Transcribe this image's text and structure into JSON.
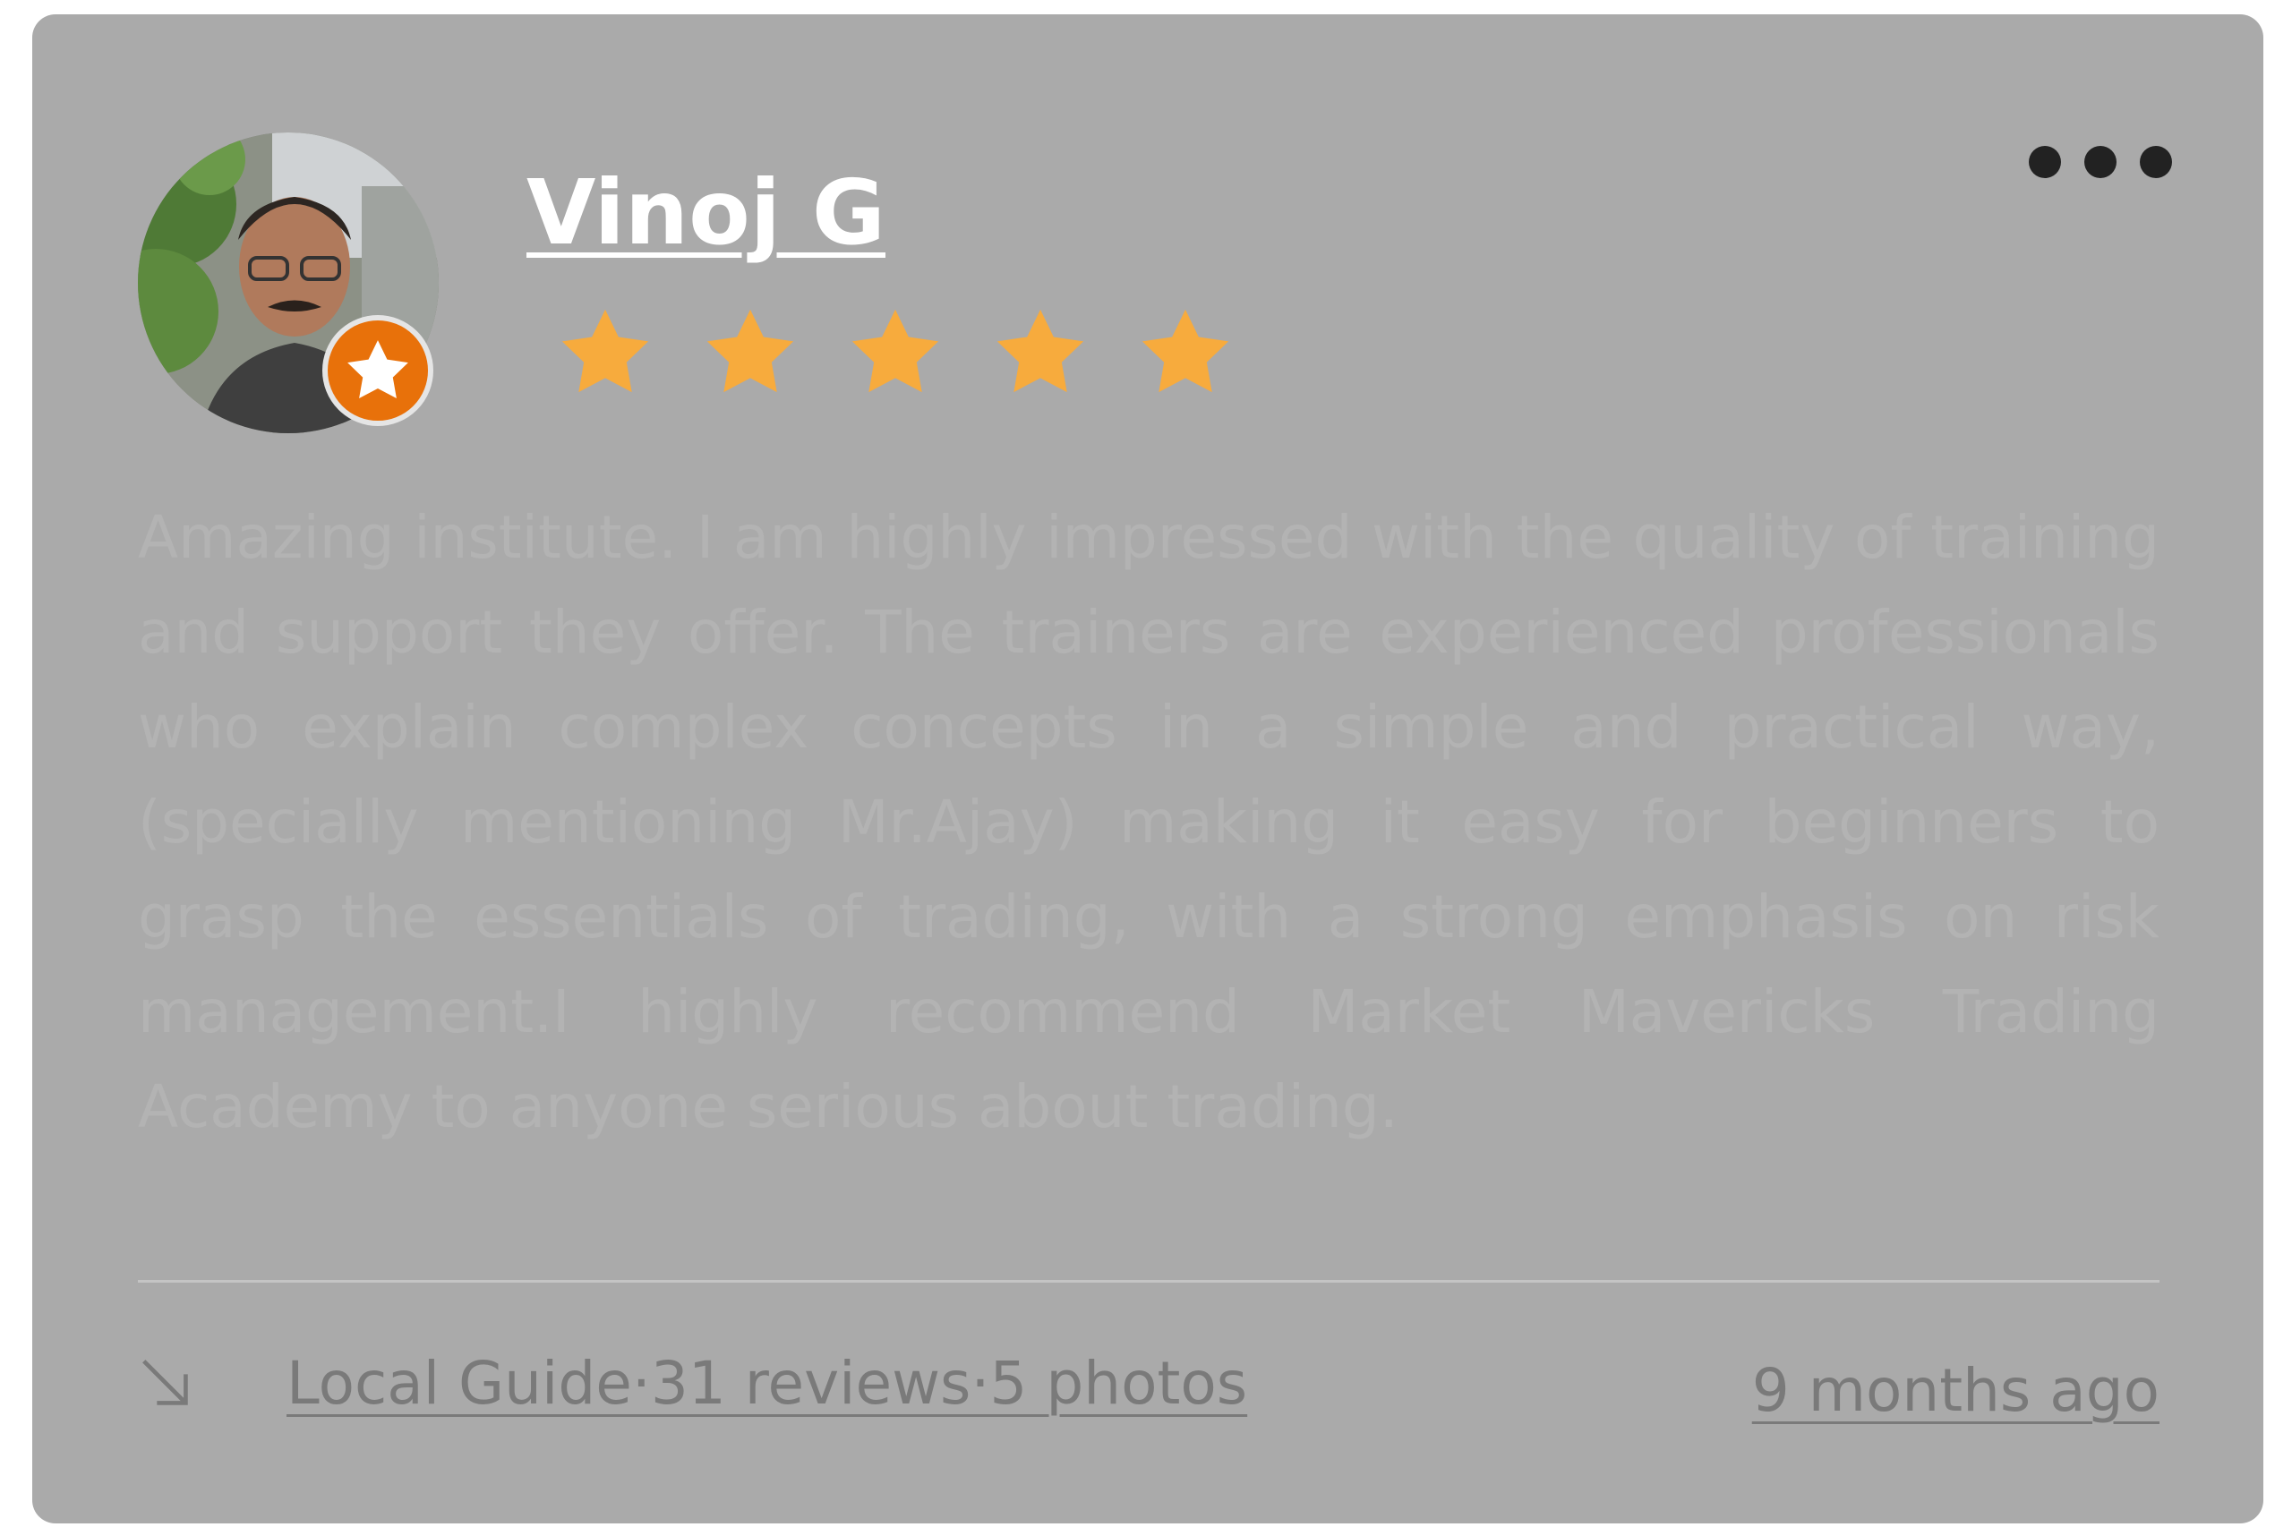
{
  "review": {
    "reviewer_name": "Vinoj G",
    "rating": 5,
    "rating_max": 5,
    "text": "Amazing institute. I am highly impressed with the quality of training and support they offer. The trainers are experienced professionals who explain complex concepts in a simple and practical way, (specially mentioning Mr.Ajay) making it easy for beginners to grasp the essentials of trading, with a strong emphasis on risk management.I highly recommend Market Mavericks Trading Academy to anyone serious about trading.",
    "reviewer_meta": "Local Guide·31 reviews·5 photos",
    "date": "9 months ago"
  },
  "icons": {
    "avatar": "reviewer-avatar-photo",
    "badge": "local-guide-star-badge",
    "more": "more-options-dots-icon",
    "star": "star-icon",
    "arrow": "arrow-down-right-icon"
  },
  "colors": {
    "card_background": "#aaaaaa",
    "star": "#f7ab3d",
    "badge": "#e8710a",
    "name": "#ffffff",
    "meta_text": "#7a7a7a",
    "review_text": "#b3b3b3"
  }
}
